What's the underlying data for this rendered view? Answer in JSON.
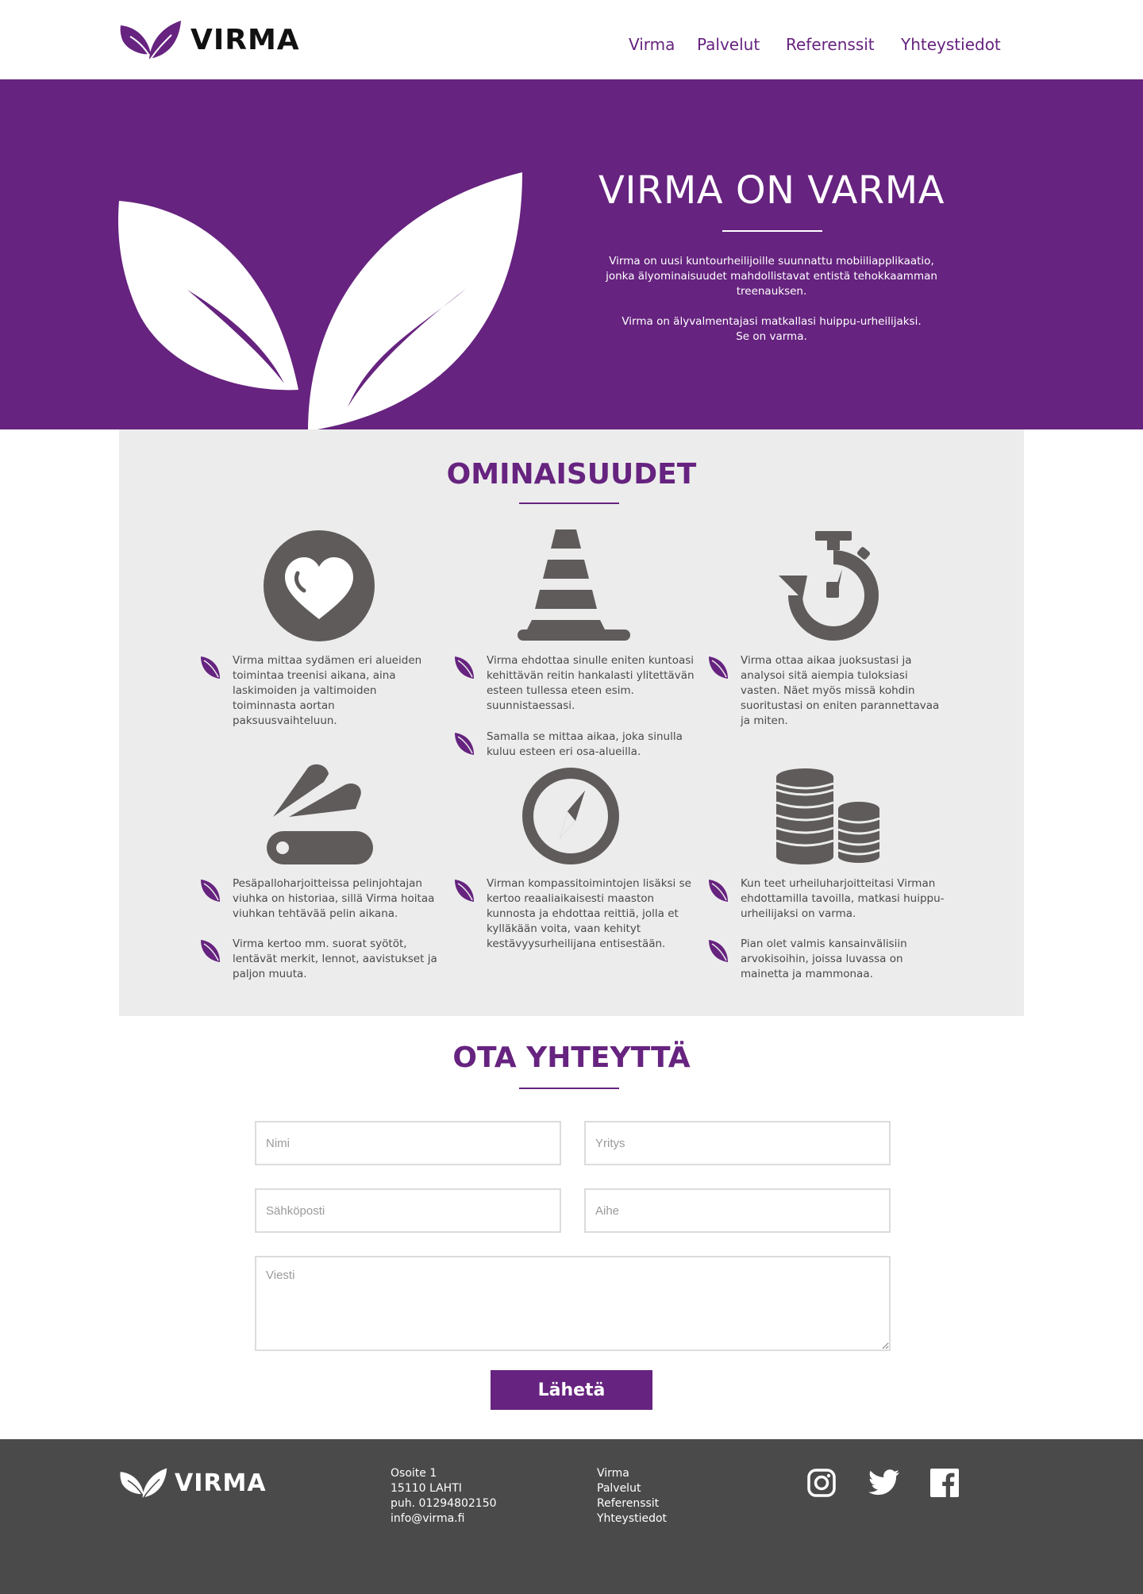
{
  "header": {
    "brand": "VIRMA",
    "nav": [
      "Virma",
      "Palvelut",
      "Referenssit",
      "Yhteystiedot"
    ]
  },
  "hero": {
    "title": "VIRMA ON VARMA",
    "paragraph1": "Virma on uusi kuntourheilijoille suunnattu mobiiliapplikaatio, jonka älyominaisuudet mahdollistavat entistä tehokkaamman treenauksen.",
    "paragraph2_line1": "Virma on älyvalmentajasi matkallasi huippu-urheilijaksi.",
    "paragraph2_line2": "Se on varma."
  },
  "features": {
    "title": "OMINAISUUDET",
    "items": [
      {
        "icon": "heart-icon",
        "bullets": [
          "Virma mittaa sydämen eri alueiden toimintaa treenisi aikana, aina laskimoiden ja valtimoiden toiminnasta aortan paksuusvaihteluun."
        ]
      },
      {
        "icon": "traffic-cone-icon",
        "bullets": [
          "Virma ehdottaa sinulle eniten kuntoasi kehittävän reitin hankalasti ylitettävän esteen tullessa eteen esim. suunnistaessasi.",
          "Samalla se mittaa aikaa, joka sinulla kuluu esteen eri osa-alueilla."
        ]
      },
      {
        "icon": "stopwatch-icon",
        "bullets": [
          "Virma ottaa aikaa juoksustasi ja analysoi sitä aiempia tuloksiasi vasten. Näet myös missä kohdin suoritustasi on eniten parannettavaa ja miten."
        ]
      },
      {
        "icon": "swiss-knife-icon",
        "bullets": [
          "Pesäpalloharjoitteissa pelinjohtajan viuhka on historiaa, sillä Virma hoitaa viuhkan tehtävää pelin aikana.",
          "Virma kertoo mm. suorat syötöt, lentävät merkit, lennot, aavistukset ja paljon muuta."
        ]
      },
      {
        "icon": "compass-icon",
        "bullets": [
          "Virman kompassitoimintojen lisäksi se kertoo reaaliaikaisesti maaston kunnosta ja ehdottaa reittiä, jolla et kylläkään voita, vaan kehityt kestävyysurheilijana entisestään."
        ]
      },
      {
        "icon": "coins-icon",
        "bullets": [
          "Kun teet urheiluharjoitteitasi Virman ehdottamilla tavoilla, matkasi huippu-urheilijaksi on varma.",
          "Pian olet valmis kansainvälisiin arvokisoihin, joissa luvassa on mainetta ja mammonaa."
        ]
      }
    ]
  },
  "contact": {
    "title": "OTA YHTEYTTÄ",
    "name_placeholder": "Nimi",
    "company_placeholder": "Yritys",
    "email_placeholder": "Sähköposti",
    "subject_placeholder": "Aihe",
    "message_placeholder": "Viesti",
    "send_label": "Lähetä"
  },
  "footer": {
    "brand": "VIRMA",
    "address": [
      "Osoite 1",
      "15110 LAHTI",
      "puh. 01294802150",
      "info@virma.fi"
    ],
    "links": [
      "Virma",
      "Palvelut",
      "Referenssit",
      "Yhteystiedot"
    ],
    "social": [
      "instagram-icon",
      "twitter-icon",
      "facebook-icon"
    ]
  },
  "colors": {
    "brand": "#66237f",
    "icon_gray": "#5f5b5a",
    "feature_bg": "#ececec",
    "footer_bg": "#4a4a4a"
  }
}
